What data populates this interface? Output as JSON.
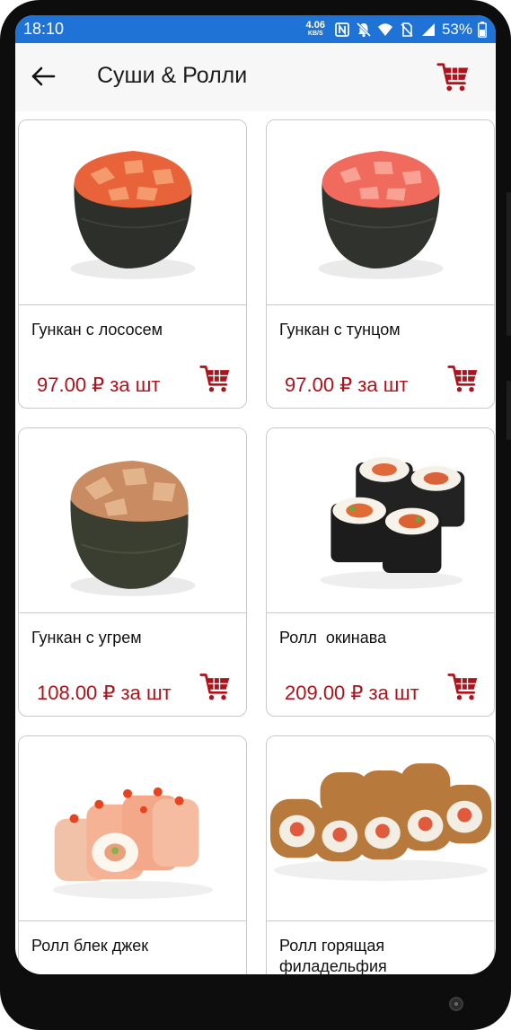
{
  "status_bar": {
    "time": "18:10",
    "net_speed_value": "4.06",
    "net_speed_unit": "KB/S",
    "battery": "53%",
    "color": "#1f72d6"
  },
  "app_bar": {
    "title": "Суши & Ролли",
    "back_icon": "arrow-left-icon",
    "cart_icon": "shopping-cart-icon"
  },
  "accent_color": "#b0121b",
  "products": [
    {
      "name": "Гункан с лососем",
      "price": "97.00 ₽ за шт",
      "image": "gunkan-salmon"
    },
    {
      "name": "Гункан с тунцом",
      "price": "97.00 ₽ за шт",
      "image": "gunkan-tuna"
    },
    {
      "name": "Гункан с угрем",
      "price": "108.00 ₽ за шт",
      "image": "gunkan-eel"
    },
    {
      "name": "Ролл  окинава",
      "price": "209.00 ₽ за шт",
      "image": "roll-okinawa"
    },
    {
      "name": "Ролл блек джек",
      "price": "",
      "image": "roll-black-jack"
    },
    {
      "name": "Ролл горящая\nфиладельфия",
      "price": "",
      "image": "roll-hot-philadelphia"
    }
  ]
}
